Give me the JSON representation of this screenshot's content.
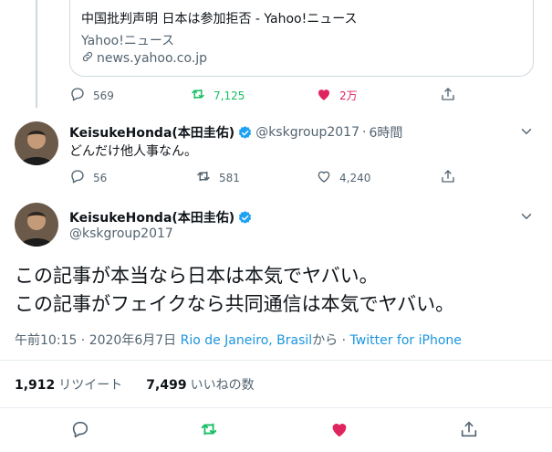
{
  "link_card": {
    "title": "中国批判声明 日本は参加拒否 - Yahoo!ニュース",
    "site": "Yahoo!ニュース",
    "url": "news.yahoo.co.jp"
  },
  "first_tweet_actions": {
    "reply_count": "569",
    "retweet_count": "7,125",
    "like_count": "2万"
  },
  "reply_tweet": {
    "display_name": "KeisukeHonda(本田圭佑)",
    "handle": "@kskgroup2017",
    "separator": "·",
    "time": "6時間",
    "text": "どんだけ他人事なん。",
    "reply_count": "56",
    "retweet_count": "581",
    "like_count": "4,240"
  },
  "main_tweet": {
    "display_name": "KeisukeHonda(本田圭佑)",
    "handle": "@kskgroup2017",
    "text_line1": "この記事が本当なら日本は本気でヤバい。",
    "text_line2": "この記事がフェイクなら共同通信は本気でヤバい。",
    "timestamp": "午前10:15 · 2020年6月7日",
    "location": "Rio de Janeiro, Brasil",
    "location_suffix": "から ·",
    "client": "Twitter for iPhone",
    "retweets_value": "1,912",
    "retweets_label": "リツイート",
    "likes_value": "7,499",
    "likes_label": "いいねの数"
  },
  "colors": {
    "text": "#0f1419",
    "muted": "#536471",
    "link": "#1b95e0",
    "retweet_active": "#17bf63",
    "like_active": "#e0245e",
    "verified": "#1da1f2"
  },
  "icons": [
    "reply-icon",
    "retweet-icon",
    "heart-icon",
    "share-icon",
    "link-icon",
    "verified-badge-icon",
    "chevron-down-icon"
  ]
}
